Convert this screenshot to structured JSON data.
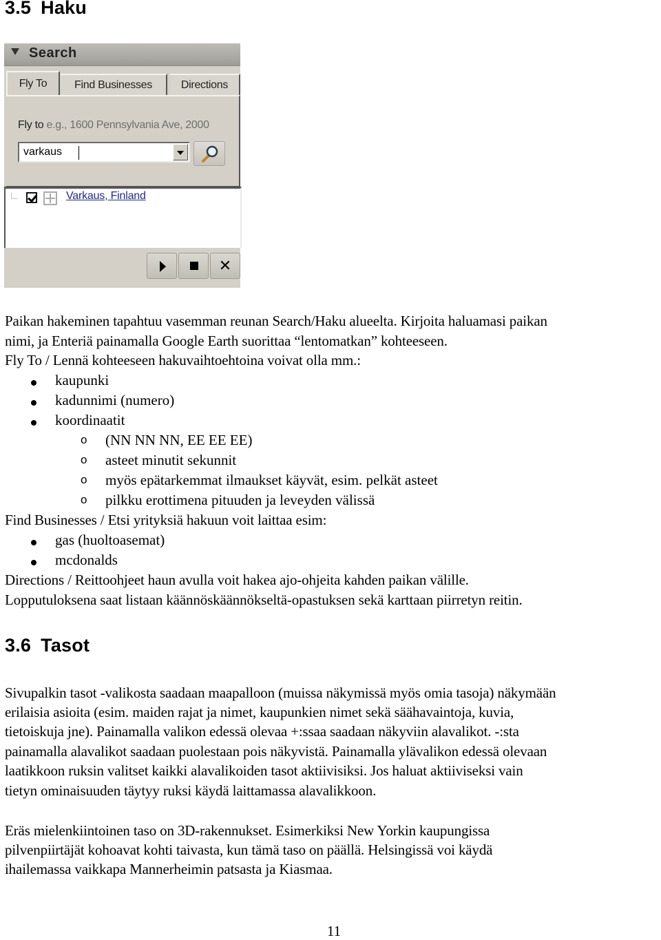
{
  "section_35": {
    "number": "3.5",
    "title": "Haku"
  },
  "search_panel": {
    "title": "Search",
    "tabs": [
      {
        "label": "Fly To",
        "active": true
      },
      {
        "label": "Find Businesses",
        "active": false
      },
      {
        "label": "Directions",
        "active": false
      }
    ],
    "fly_to_label": "Fly to",
    "fly_to_hint": "e.g., 1600 Pennsylvania Ave, 2000",
    "search_value": "varkaus",
    "results": [
      {
        "label": "Varkaus, Finland",
        "checked": true
      }
    ],
    "controls": {
      "play": "play",
      "stop": "stop",
      "close": "✕"
    }
  },
  "paragraph_1": [
    "Paikan hakeminen tapahtuu vasemman reunan Search/Haku alueelta. Kirjoita haluamasi paikan",
    "nimi, ja Enteriä painamalla Google Earth suorittaa “lentomatkan” kohteeseen.",
    "Fly To / Lennä kohteeseen hakuvaihtoehtoina voivat olla mm.:"
  ],
  "fly_to_options": [
    {
      "text": "kaupunki"
    },
    {
      "text": "kadunnimi (numero)"
    },
    {
      "text": "koordinaatit",
      "sub": [
        "(NN NN NN, EE EE EE)",
        "asteet minutit sekunnit",
        "myös epätarkemmat ilmaukset käyvät, esim. pelkät asteet",
        "pilkku erottimena pituuden ja leveyden välissä"
      ]
    }
  ],
  "find_businesses_intro": "Find Businesses / Etsi yrityksiä hakuun voit laittaa esim:",
  "find_businesses_examples": [
    "gas (huoltoasemat)",
    "mcdonalds"
  ],
  "directions_text": [
    "Directions / Reittoohjeet haun avulla voit hakea ajo-ohjeita kahden paikan välille.",
    "Lopputuloksena saat listaan käännöskäännökseltä-opastuksen sekä karttaan piirretyn reitin."
  ],
  "section_36": {
    "number": "3.6",
    "title": "Tasot"
  },
  "paragraph_layers": [
    "Sivupalkin tasot -valikosta saadaan maapalloon (muissa näkymissä myös omia tasoja) näkymään",
    "erilaisia asioita (esim. maiden rajat ja nimet, kaupunkien nimet sekä säähavaintoja, kuvia,",
    "tietoiskuja jne). Painamalla valikon edessä olevaa +:ssaa saadaan näkyviin alavalikot.  -:sta",
    "painamalla alavalikot saadaan puolestaan pois näkyvistä. Painamalla ylävalikon edessä olevaan",
    "laatikkoon ruksin valitset kaikki alavalikoiden tasot aktiivisiksi. Jos haluat aktiiviseksi vain",
    "tietyn ominaisuuden täytyy ruksi käydä laittamassa alavalikkoon."
  ],
  "paragraph_3d": [
    "Eräs mielenkiintoinen taso on 3D-rakennukset. Esimerkiksi New Yorkin kaupungissa",
    "pilvenpiirtäjät kohoavat kohti taivasta, kun tämä taso on päällä. Helsingissä voi käydä",
    "ihailemassa vaikkapa Mannerheimin patsasta ja Kiasmaa."
  ],
  "page_number": "11"
}
